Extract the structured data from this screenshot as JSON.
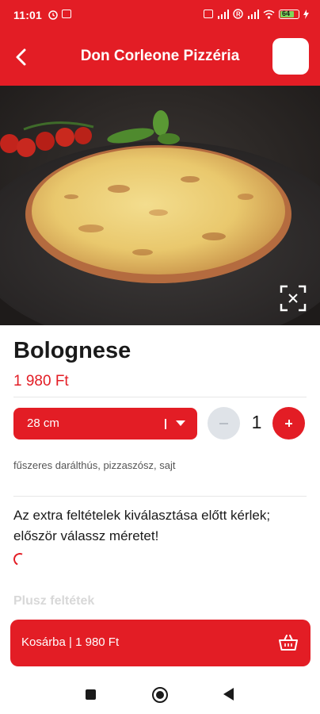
{
  "status_bar": {
    "time": "11:01",
    "battery": "64"
  },
  "header": {
    "title": "Don Corleone Pizzéria",
    "back_icon": "chevron-left-icon",
    "cart_icon": "cart-icon"
  },
  "product": {
    "name": "Bolognese",
    "price": "1 980 Ft",
    "image_icon": "expand-icon",
    "size": {
      "selected": "28 cm"
    },
    "quantity": "1",
    "ingredients": "fűszeres darálthús, pizzaszósz, sajt"
  },
  "notice": "Az extra feltételek kiválasztása előtt kérlek; először válassz méretet!",
  "extras_heading": "Plusz feltétek",
  "cart_button": {
    "label": "Kosárba | 1 980 Ft",
    "icon": "basket-icon"
  },
  "nav": {
    "recents_icon": "square-icon",
    "home_icon": "circle-icon",
    "back_icon": "triangle-back-icon"
  },
  "colors": {
    "accent": "#e31d25",
    "disabled": "#dfe3e8"
  }
}
